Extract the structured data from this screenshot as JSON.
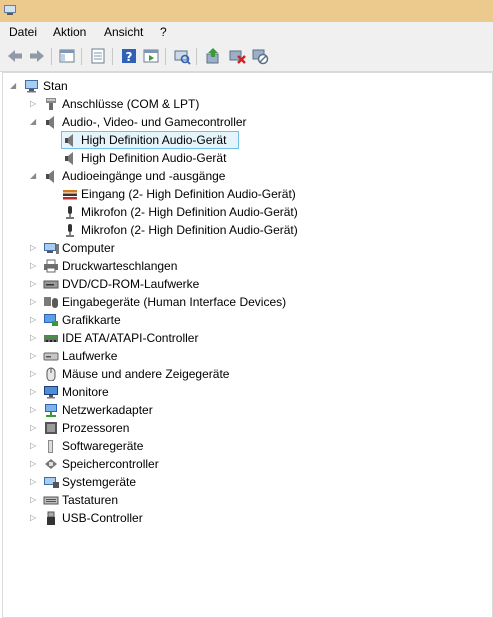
{
  "menu": [
    "Datei",
    "Aktion",
    "Ansicht",
    "?"
  ],
  "toolbar_icons": [
    "back-arrow-icon",
    "forward-arrow-icon",
    "show-hide-console-tree-icon",
    "properties-icon",
    "help-icon",
    "action-pane-icon",
    "scan-hardware-changes-icon",
    "update-driver-icon",
    "uninstall-device-icon",
    "disable-device-icon"
  ],
  "tree": {
    "root": "Stan",
    "categories": [
      {
        "label": "Anschlüsse (COM & LPT)",
        "icon": "port-icon",
        "expanded": false
      },
      {
        "label": "Audio-, Video- und Gamecontroller",
        "icon": "speaker-icon",
        "expanded": true,
        "children": [
          {
            "label": "High Definition Audio-Gerät",
            "icon": "speaker-icon",
            "selected": true
          },
          {
            "label": "High Definition Audio-Gerät",
            "icon": "speaker-icon",
            "selected": false
          }
        ]
      },
      {
        "label": "Audioeingänge und -ausgänge",
        "icon": "speaker-icon",
        "expanded": true,
        "children": [
          {
            "label": "Eingang (2- High Definition Audio-Gerät)",
            "icon": "audio-jack-icon"
          },
          {
            "label": "Mikrofon (2- High Definition Audio-Gerät)",
            "icon": "microphone-icon"
          },
          {
            "label": "Mikrofon (2- High Definition Audio-Gerät)",
            "icon": "microphone-icon"
          }
        ]
      },
      {
        "label": "Computer",
        "icon": "computer-icon",
        "expanded": false
      },
      {
        "label": "Druckwarteschlangen",
        "icon": "printer-icon",
        "expanded": false
      },
      {
        "label": "DVD/CD-ROM-Laufwerke",
        "icon": "disc-drive-icon",
        "expanded": false
      },
      {
        "label": "Eingabegeräte (Human Interface Devices)",
        "icon": "hid-icon",
        "expanded": false
      },
      {
        "label": "Grafikkarte",
        "icon": "display-adapter-icon",
        "expanded": false
      },
      {
        "label": "IDE ATA/ATAPI-Controller",
        "icon": "ide-controller-icon",
        "expanded": false
      },
      {
        "label": "Laufwerke",
        "icon": "disk-drive-icon",
        "expanded": false
      },
      {
        "label": "Mäuse und andere Zeigegeräte",
        "icon": "mouse-icon",
        "expanded": false
      },
      {
        "label": "Monitore",
        "icon": "monitor-icon",
        "expanded": false
      },
      {
        "label": "Netzwerkadapter",
        "icon": "network-adapter-icon",
        "expanded": false
      },
      {
        "label": "Prozessoren",
        "icon": "processor-icon",
        "expanded": false
      },
      {
        "label": "Softwaregeräte",
        "icon": "software-device-icon",
        "expanded": false
      },
      {
        "label": "Speichercontroller",
        "icon": "storage-controller-icon",
        "expanded": false
      },
      {
        "label": "Systemgeräte",
        "icon": "system-device-icon",
        "expanded": false
      },
      {
        "label": "Tastaturen",
        "icon": "keyboard-icon",
        "expanded": false
      },
      {
        "label": "USB-Controller",
        "icon": "usb-icon",
        "expanded": false
      }
    ]
  }
}
